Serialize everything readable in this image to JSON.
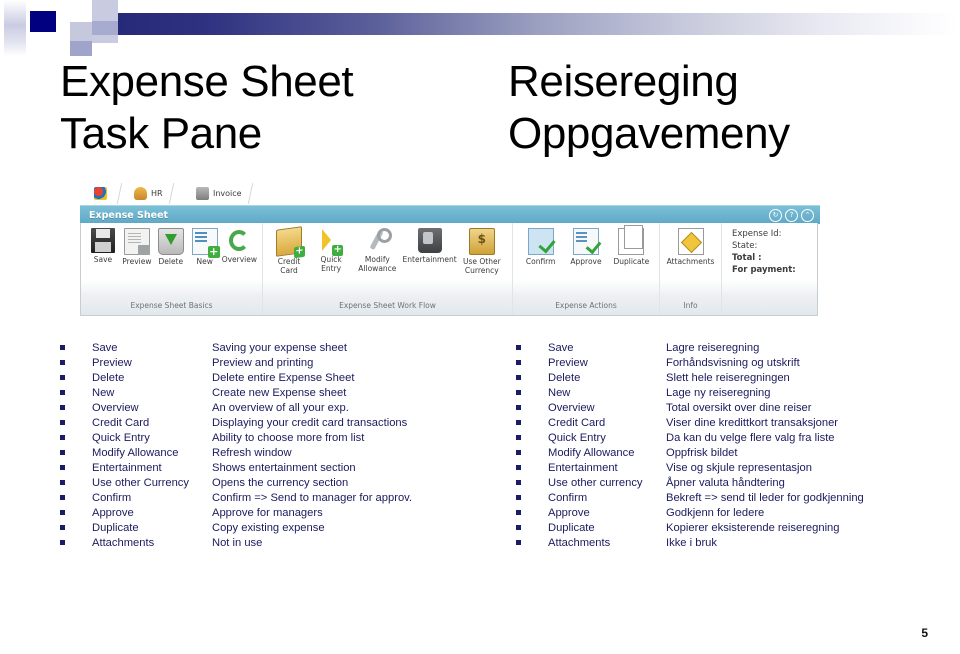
{
  "slide": {
    "page_number": "5",
    "accent_navy": "#000080",
    "accent_lavender": "#c6c8de",
    "bullet_color": "#1b1b6a"
  },
  "title_left": {
    "line1": "Expense Sheet",
    "line2": "Task Pane"
  },
  "title_right": {
    "line1": "Reisereging",
    "line2": "Oppgavemeny"
  },
  "ribbon": {
    "tabs": [
      {
        "label": "",
        "icon": "home-icon"
      },
      {
        "label": "HR",
        "icon": "hr-icon"
      },
      {
        "label": "Invoice",
        "icon": "invoice-icon"
      }
    ],
    "title": "Expense Sheet",
    "window_buttons": [
      "↻",
      "?",
      "⌃"
    ],
    "groups": [
      {
        "name": "Expense Sheet Basics",
        "items": [
          {
            "label": "Save",
            "icon": "save-icon"
          },
          {
            "label": "Preview",
            "icon": "preview-icon"
          },
          {
            "label": "Delete",
            "icon": "delete-icon"
          },
          {
            "label": "New",
            "icon": "new-icon"
          },
          {
            "label": "Overview",
            "icon": "overview-icon"
          }
        ]
      },
      {
        "name": "Expense Sheet Work Flow",
        "items": [
          {
            "label": "Credit\nCard",
            "icon": "credit-card-icon"
          },
          {
            "label": "Quick\nEntry",
            "icon": "quick-entry-icon"
          },
          {
            "label": "Modify\nAllowance",
            "icon": "modify-allowance-icon"
          },
          {
            "label": "Entertainment",
            "icon": "entertainment-icon"
          },
          {
            "label": "Use Other\nCurrency",
            "icon": "use-other-currency-icon"
          }
        ]
      },
      {
        "name": "Expense Actions",
        "items": [
          {
            "label": "Confirm",
            "icon": "confirm-icon"
          },
          {
            "label": "Approve",
            "icon": "approve-icon"
          },
          {
            "label": "Duplicate",
            "icon": "duplicate-icon"
          }
        ]
      },
      {
        "name": "Info",
        "items": [
          {
            "label": "Attachments",
            "icon": "attachments-icon"
          }
        ]
      }
    ],
    "info_panel": [
      {
        "text": "Expense Id:",
        "bold": false
      },
      {
        "text": "State:",
        "bold": false
      },
      {
        "text": "Total :",
        "bold": true
      },
      {
        "text": "For payment:",
        "bold": true
      }
    ]
  },
  "list_left": [
    {
      "term": "Save",
      "desc": "Saving your expense sheet"
    },
    {
      "term": "Preview",
      "desc": "Preview and printing"
    },
    {
      "term": "Delete",
      "desc": "Delete entire Expense Sheet"
    },
    {
      "term": "New",
      "desc": "Create new Expense sheet"
    },
    {
      "term": "Overview",
      "desc": "An overview of all your exp."
    },
    {
      "term": "Credit Card",
      "desc": "Displaying your credit card transactions"
    },
    {
      "term": "Quick Entry",
      "desc": "Ability to choose more from list"
    },
    {
      "term": "Modify Allowance",
      "desc": "Refresh window"
    },
    {
      "term": "Entertainment",
      "desc": "Shows entertainment section"
    },
    {
      "term": "Use other Currency",
      "desc": "Opens the currency section"
    },
    {
      "term": "Confirm",
      "desc": "Confirm => Send to manager for approv."
    },
    {
      "term": "Approve",
      "desc": "Approve for managers"
    },
    {
      "term": "Duplicate",
      "desc": "Copy existing expense"
    },
    {
      "term": "Attachments",
      "desc": "Not in use"
    }
  ],
  "list_right": [
    {
      "term": "Save",
      "desc": "Lagre reiseregning"
    },
    {
      "term": "Preview",
      "desc": "Forhåndsvisning og utskrift"
    },
    {
      "term": "Delete",
      "desc": "Slett hele reiseregningen"
    },
    {
      "term": "New",
      "desc": "Lage ny reiseregning"
    },
    {
      "term": "Overview",
      "desc": "Total oversikt over dine reiser"
    },
    {
      "term": "Credit Card",
      "desc": "Viser dine kredittkort transaksjoner"
    },
    {
      "term": "Quick Entry",
      "desc": "Da kan du velge flere  valg fra liste"
    },
    {
      "term": "Modify Allowance",
      "desc": "Oppfrisk bildet"
    },
    {
      "term": "Entertainment",
      "desc": "Vise og skjule representasjon"
    },
    {
      "term": "Use other currency",
      "desc": "Åpner valuta håndtering"
    },
    {
      "term": "Confirm",
      "desc": "Bekreft => send til leder for godkjenning"
    },
    {
      "term": "Approve",
      "desc": "Godkjenn for ledere"
    },
    {
      "term": "Duplicate",
      "desc": "Kopierer eksisterende reiseregning"
    },
    {
      "term": "Attachments",
      "desc": "Ikke i  bruk"
    }
  ]
}
